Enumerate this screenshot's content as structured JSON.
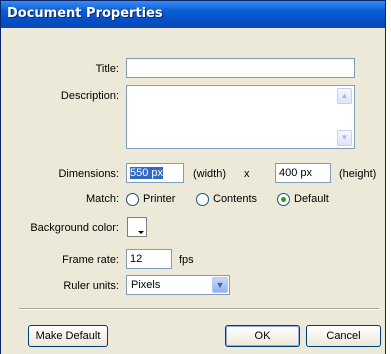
{
  "window": {
    "title": "Document Properties"
  },
  "form": {
    "title_label": "Title:",
    "title_value": "",
    "description_label": "Description:",
    "description_value": "",
    "dimensions_label": "Dimensions:",
    "width_value": "550 px",
    "width_unit_label": "(width)",
    "times_label": "x",
    "height_value": "400 px",
    "height_unit_label": "(height)",
    "match_label": "Match:",
    "match_options": [
      "Printer",
      "Contents",
      "Default"
    ],
    "match_selected": "Default",
    "background_color_label": "Background color:",
    "background_color_value": "#ffffff",
    "frame_rate_label": "Frame rate:",
    "frame_rate_value": "12",
    "frame_rate_unit": "fps",
    "ruler_units_label": "Ruler units:",
    "ruler_units_value": "Pixels"
  },
  "buttons": {
    "make_default": "Make Default",
    "ok": "OK",
    "cancel": "Cancel"
  },
  "colors": {
    "titlebar": "#0a5fd8",
    "dialog_bg": "#ece9d8",
    "selection": "#316ac5",
    "radio_selected_dot": "#21a121"
  }
}
